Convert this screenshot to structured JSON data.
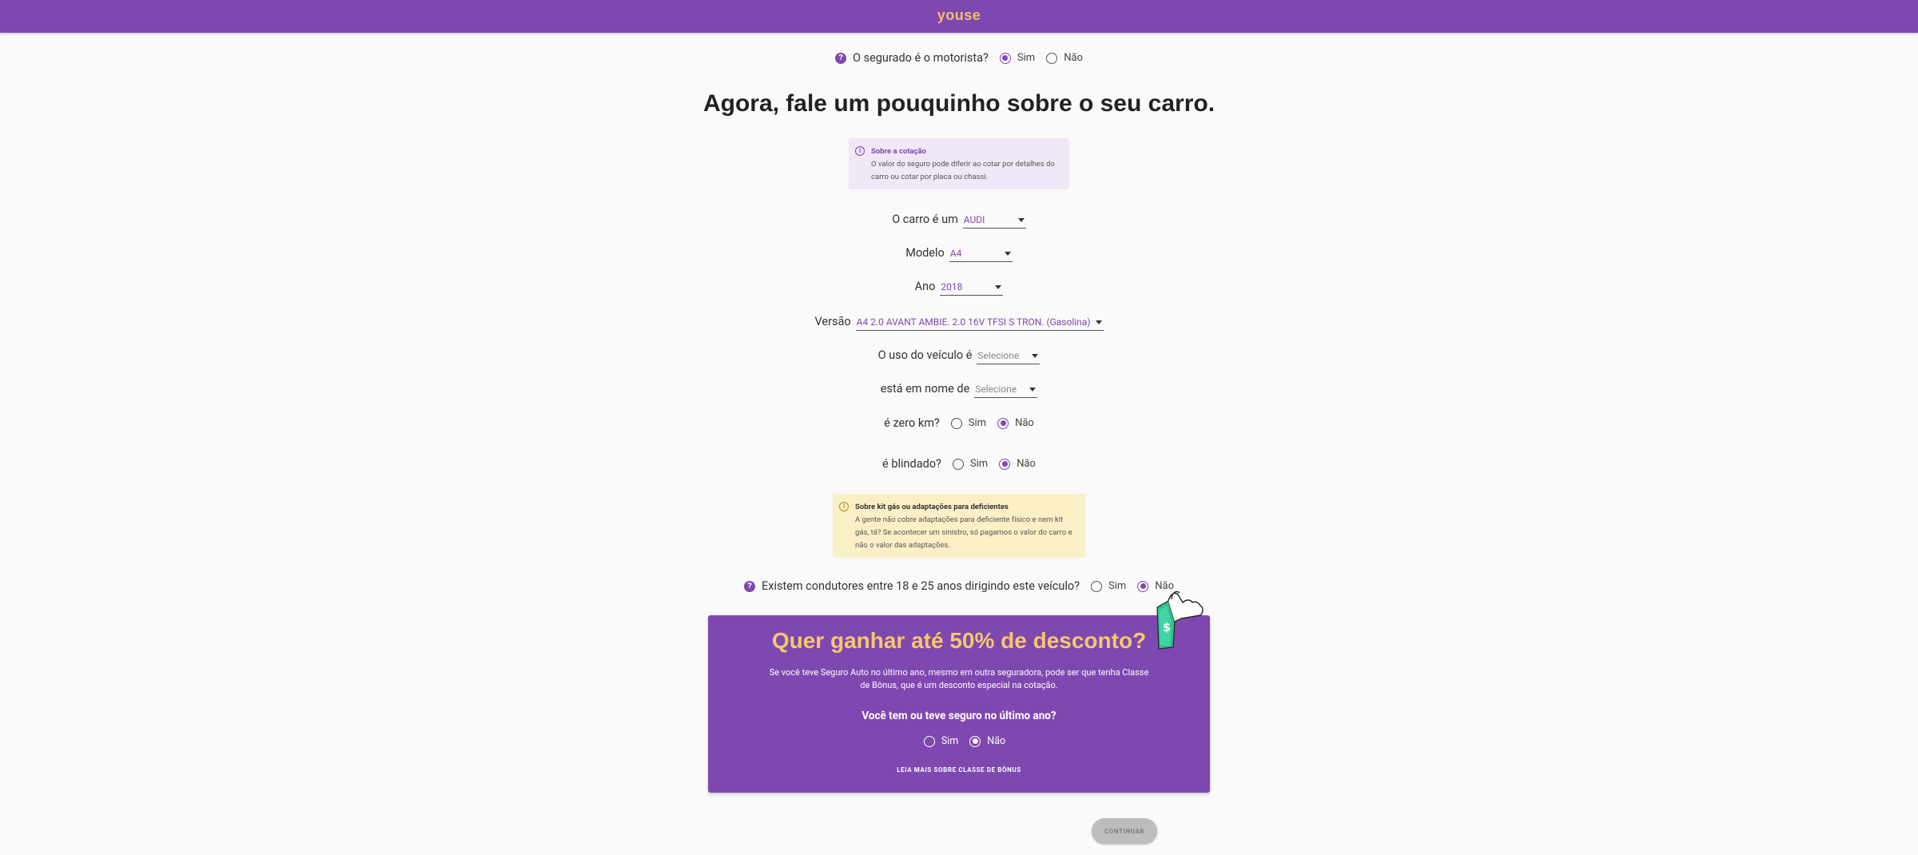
{
  "header": {
    "logo": "youse"
  },
  "driver_question": {
    "label": "O segurado é o motorista?",
    "options": [
      "Sim",
      "Não"
    ],
    "selected": "Sim"
  },
  "page_title": "Agora, fale um pouquinho sobre o seu carro.",
  "quote_info": {
    "title": "Sobre a cotação",
    "text": "O valor do seguro pode diferir ao cotar por detalhes do carro ou cotar por placa ou chassi."
  },
  "form": {
    "brand": {
      "label": "O carro é um",
      "value": "AUDI"
    },
    "model": {
      "label": "Modelo",
      "value": "A4"
    },
    "year": {
      "label": "Ano",
      "value": "2018"
    },
    "version": {
      "label": "Versão",
      "value": "A4 2.0 AVANT AMBIE. 2.0 16V TFSI S TRON. (Gasolina)"
    },
    "usage": {
      "label": "O uso do veículo é",
      "placeholder": "Selecione"
    },
    "owner": {
      "label": "está em nome de",
      "placeholder": "Selecione"
    },
    "zero_km": {
      "label": "é zero km?",
      "options": [
        "Sim",
        "Não"
      ],
      "selected": "Não"
    },
    "armored": {
      "label": "é blindado?",
      "options": [
        "Sim",
        "Não"
      ],
      "selected": "Não"
    }
  },
  "kit_info": {
    "title": "Sobre kit gás ou adaptações para deficientes",
    "text": "A gente não cobre adaptações para deficiente físico e nem kit gás, tá? Se acontecer um sinistro, só pagamos o valor do carro e não o valor das adaptações."
  },
  "young_drivers": {
    "label": "Existem condutores entre 18 e 25 anos dirigindo este veículo?",
    "options": [
      "Sim",
      "Não"
    ],
    "selected": "Não"
  },
  "promo": {
    "title": "Quer ganhar até 50% de desconto?",
    "text": "Se você teve Seguro Auto no último ano, mesmo em outra seguradora, pode ser que tenha Classe de Bônus, que é um desconto especial na cotação.",
    "question": "Você tem ou teve seguro no último ano?",
    "options": [
      "Sim",
      "Não"
    ],
    "selected": "Não",
    "link": "LEIA MAIS SOBRE CLASSE DE BÔNUS"
  },
  "continue_button": "CONTINUAR",
  "colors": {
    "brand": "#7f48b0",
    "accent": "#f5c86a",
    "info_purple_bg": "#f0e8f6",
    "info_yellow_bg": "#fbefc6"
  },
  "icons": {
    "help": "question-circle-icon",
    "info": "info-circle-icon",
    "dropdown": "chevron-down-icon"
  }
}
